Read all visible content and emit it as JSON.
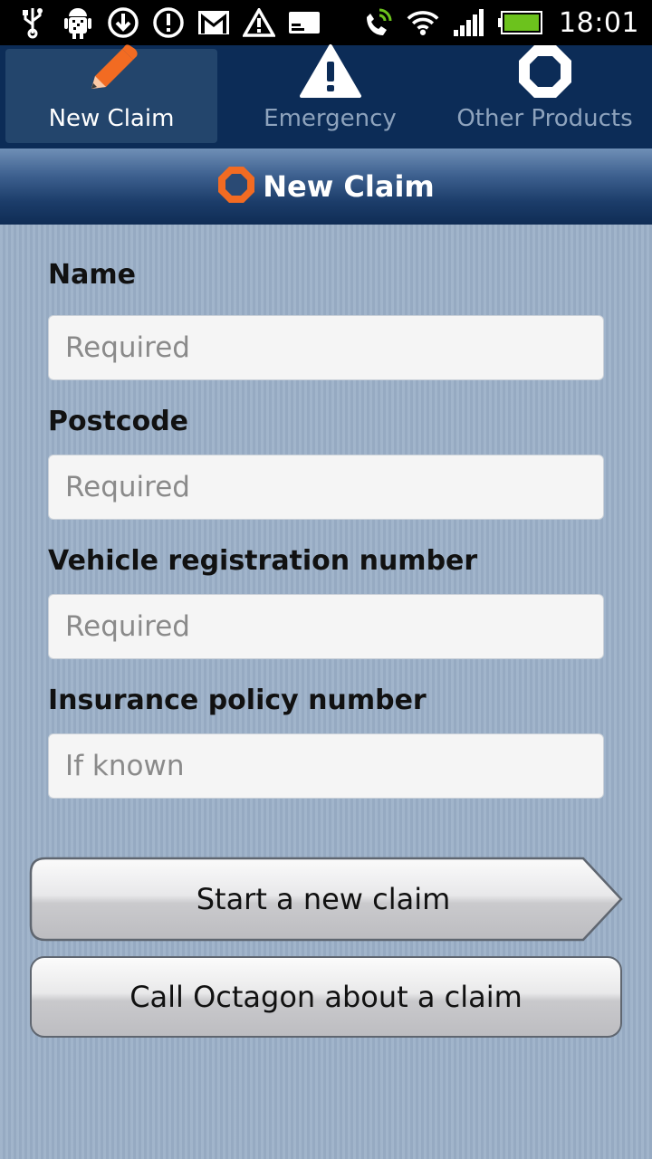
{
  "status_bar": {
    "time": "18:01",
    "left_icons": [
      "usb-icon",
      "android-debug-icon",
      "download-icon",
      "alert-circle-icon",
      "gmail-icon",
      "warning-icon",
      "card-icon"
    ],
    "right_icons": [
      "phone-signal-icon",
      "wifi-icon",
      "cell-signal-icon",
      "battery-icon"
    ]
  },
  "tabs": [
    {
      "label": "New Claim",
      "icon": "pencil-icon",
      "active": true
    },
    {
      "label": "Emergency",
      "icon": "warning-icon",
      "active": false
    },
    {
      "label": "Other Products",
      "icon": "octagon-icon",
      "active": false
    }
  ],
  "title": {
    "text": "New Claim",
    "icon": "octagon-logo-icon"
  },
  "form": {
    "name_label": "Name",
    "name_placeholder": "Required",
    "postcode_label": "Postcode",
    "postcode_placeholder": "Required",
    "vehicle_label": "Vehicle registration number",
    "vehicle_placeholder": "Required",
    "policy_label": "Insurance policy number",
    "policy_placeholder": "If known"
  },
  "buttons": {
    "start_claim": "Start a new claim",
    "call_octagon": "Call Octagon about a claim"
  },
  "colors": {
    "accent_orange": "#f26b22",
    "nav_bg": "#0c2c57",
    "active_tab_bg": "#23456c",
    "content_bg": "#9bb0c8"
  }
}
